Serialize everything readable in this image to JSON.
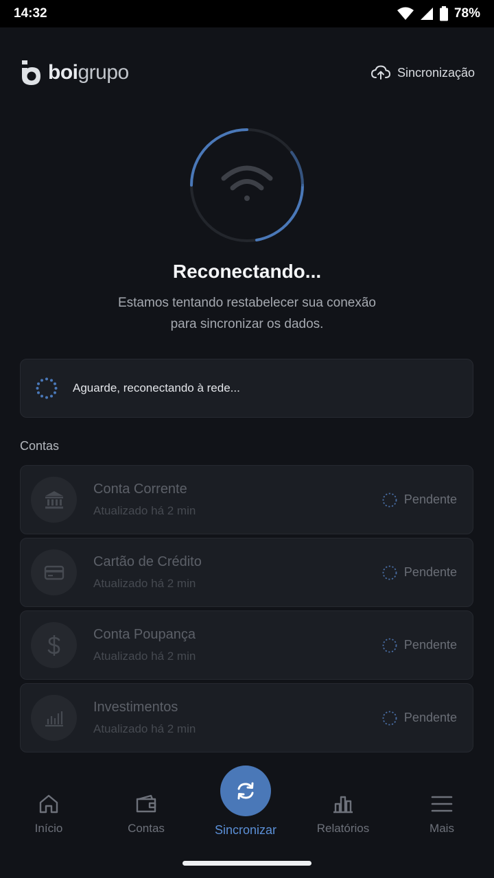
{
  "status_bar": {
    "time": "14:32",
    "battery": "78%"
  },
  "header": {
    "logo_bold": "boi",
    "logo_light": "grupo",
    "sync_label": "Sincronização"
  },
  "main": {
    "title": "Reconectando...",
    "subtitle_line1": "Estamos tentando restabelecer sua conexão",
    "subtitle_line2": "para sincronizar os dados.",
    "notice": "Aguarde, reconectando à rede...",
    "section_label": "Contas"
  },
  "accounts": [
    {
      "name": "Conta Corrente",
      "updated": "Atualizado há 2 min",
      "status": "Pendente",
      "icon": "bank-icon"
    },
    {
      "name": "Cartão de Crédito",
      "updated": "Atualizado há 2 min",
      "status": "Pendente",
      "icon": "credit-card-icon"
    },
    {
      "name": "Conta Poupança",
      "updated": "Atualizado há 2 min",
      "status": "Pendente",
      "icon": "dollar-icon"
    },
    {
      "name": "Investimentos",
      "updated": "Atualizado há 2 min",
      "status": "Pendente",
      "icon": "chart-icon"
    }
  ],
  "nav": {
    "home": "Início",
    "accounts": "Contas",
    "sync": "Sincronizar",
    "reports": "Relatórios",
    "more": "Mais"
  },
  "colors": {
    "accent": "#4a78b8",
    "background": "#111318",
    "card": "#1b1e24"
  }
}
